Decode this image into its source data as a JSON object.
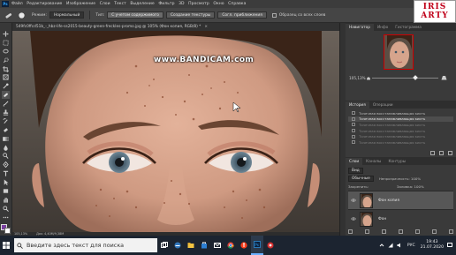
{
  "app": {
    "name": "Adobe Photoshop",
    "logo": "Ps"
  },
  "menubar": {
    "items": [
      "Файл",
      "Редактирование",
      "Изображение",
      "Слои",
      "Текст",
      "Выделение",
      "Фильтр",
      "3D",
      "Просмотр",
      "Окно",
      "Справка"
    ]
  },
  "options": {
    "mode_label": "Режим:",
    "mode_value": "Нормальный",
    "type_label": "Тип:",
    "type_btn1": "С учетом содержимого",
    "type_btn2": "Создание текстуры",
    "type_btn3": "Согл. приближения",
    "sample_label": "Образец со всех слоев"
  },
  "brand": {
    "line1": "IRIS",
    "line2": "ARTY"
  },
  "document": {
    "tab_title": "549fc0ffcd51b_-_hbz-life-ss2015-beauty-green-freckles-promo.jpg @ 105% (Фон копия, RGB/8) *",
    "close": "×",
    "watermark": "www.BANDICAM.com"
  },
  "status": {
    "zoom": "105,13%",
    "doc_info": "Док: 4,40М/9,38М"
  },
  "navigator": {
    "tabs": [
      "Навигатор",
      "Инфо",
      "Гистограмма"
    ],
    "zoom": "105,13%",
    "slider_position": 0.62
  },
  "history": {
    "tabs": [
      "История",
      "Операции"
    ],
    "items": [
      {
        "label": "Точечная восстанавливающая кисть",
        "state": "normal"
      },
      {
        "label": "Точечная восстанавливающая кисть",
        "state": "current"
      },
      {
        "label": "Точечная восстанавливающая кисть",
        "state": "dim"
      },
      {
        "label": "Точечная восстанавливающая кисть",
        "state": "dim"
      },
      {
        "label": "Точечная восстанавливающая кисть",
        "state": "dim"
      },
      {
        "label": "Точечная восстанавливающая кисть",
        "state": "dim"
      }
    ]
  },
  "layers": {
    "tabs": [
      "Слои",
      "Каналы",
      "Контуры"
    ],
    "filter": "Вид",
    "blend": "Обычные",
    "opacity": "Непрозрачность: 100%",
    "lock": "Закрепить:",
    "fill": "Заливка: 100%",
    "items": [
      {
        "name": "Фон копия",
        "active": true
      },
      {
        "name": "Фон",
        "active": false
      }
    ]
  },
  "taskbar": {
    "search_placeholder": "Введите здесь текст для поиска",
    "time": "19:43",
    "date": "21.07.2020",
    "lang": "РУС"
  },
  "colors": {
    "foreground": "#7a3ea0",
    "background": "#ffffff",
    "taskbar": "#1c2430"
  }
}
